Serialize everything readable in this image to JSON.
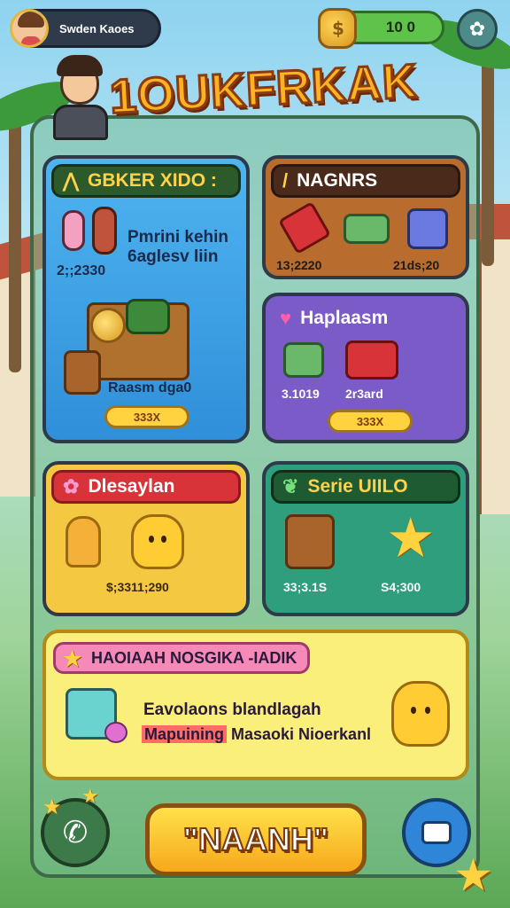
{
  "player": {
    "name": "Swden Kaoes"
  },
  "currency": {
    "value": "10 0",
    "icon": "coin-bag-icon"
  },
  "title": "1OUKFRKAK",
  "panels": {
    "quest": {
      "header": "GBKER XIDO :",
      "desc_line1": "Pmrini kehin",
      "desc_line2": "6aglesv liin",
      "amount": "2;;2330",
      "reward_label": "Raasm dga0",
      "price": "333X"
    },
    "items": {
      "header": "NAGNRS",
      "price_left": "13;2220",
      "price_right": "21ds;20"
    },
    "gifts": {
      "header": "Haplaasm",
      "label_left": "3.1019",
      "label_right": "2r3ard",
      "price": "333X"
    },
    "deals": {
      "header": "Dlesaylan",
      "price": "$;3311;290"
    },
    "series": {
      "header": "Serie UIILO",
      "price_left": "33;3.1S",
      "price_right": "S4;300"
    },
    "banner": {
      "header": "HAOIAAH NOSGIKA -IADIK",
      "line1": "Eavolaons blandlagah",
      "line2_a": "Mapuining",
      "line2_b": "Masaoki Nioerkanl"
    }
  },
  "buttons": {
    "main": "\"NAANH\""
  },
  "colors": {
    "title": "#ffb21f",
    "currency_bg": "#5fc24b",
    "main_button": "#f7a81b"
  }
}
